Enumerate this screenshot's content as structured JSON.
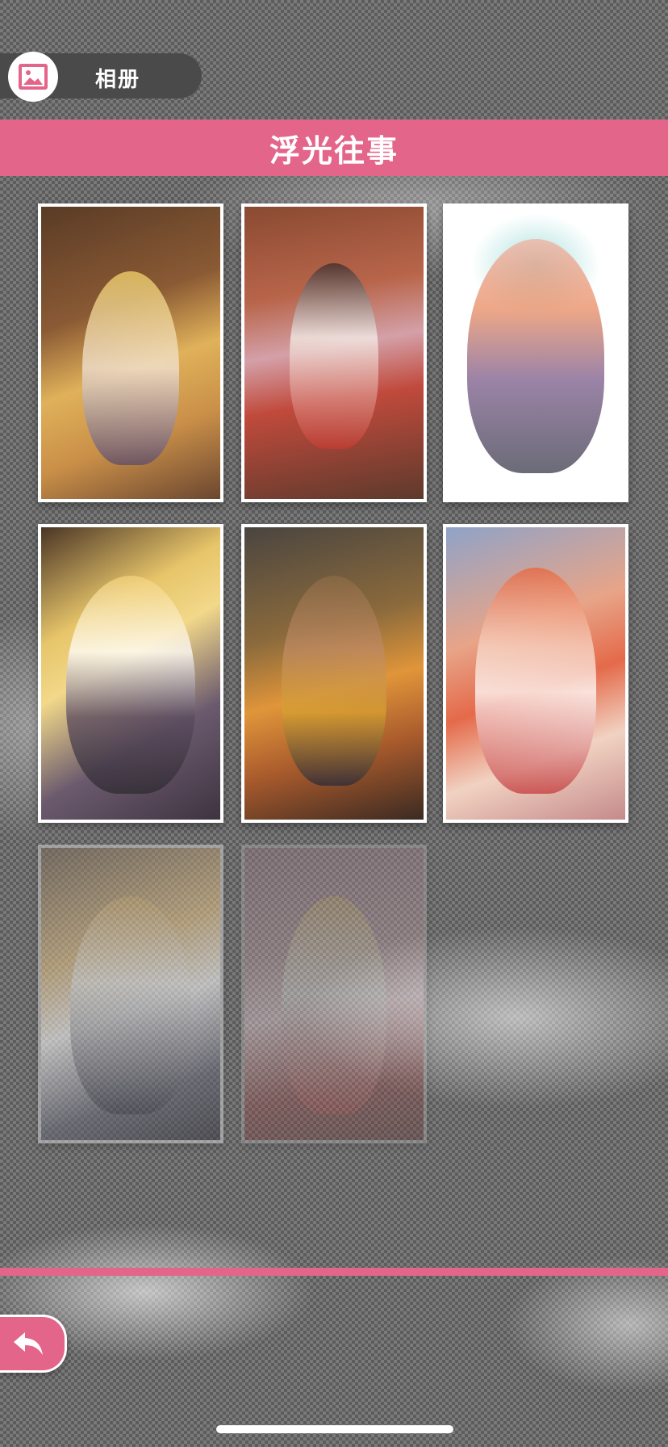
{
  "header": {
    "icon": "image-album-icon",
    "title": "相册"
  },
  "album": {
    "title": "浮光往事",
    "accent_color": "#e3658a",
    "thumbnails": [
      {
        "id": "1",
        "state": "unlocked"
      },
      {
        "id": "2",
        "state": "unlocked"
      },
      {
        "id": "3",
        "state": "unlocked"
      },
      {
        "id": "4",
        "state": "unlocked"
      },
      {
        "id": "5",
        "state": "unlocked"
      },
      {
        "id": "6",
        "state": "unlocked"
      },
      {
        "id": "7",
        "state": "faded"
      },
      {
        "id": "8",
        "state": "locked"
      }
    ]
  },
  "footer": {
    "back_icon": "back-arrow-icon"
  }
}
